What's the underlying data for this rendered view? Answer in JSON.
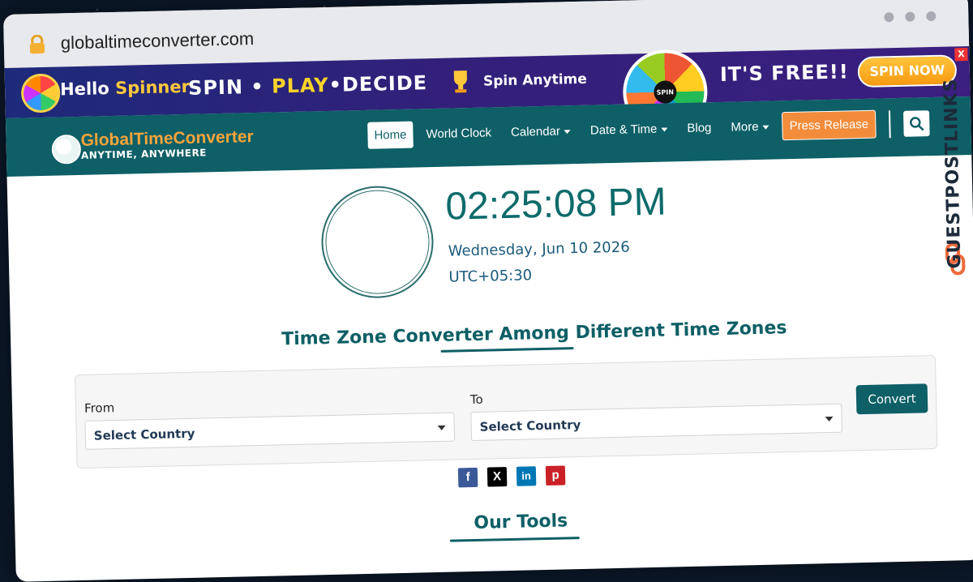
{
  "browser": {
    "url": "globaltimeconverter.com"
  },
  "ad": {
    "brand_hello": "Hello",
    "brand_spinner": "Spinner",
    "slogan_spin": "SPIN",
    "slogan_dot1": " • ",
    "slogan_play": "PLAY",
    "slogan_dot2": "•",
    "slogan_decide": "DECIDE",
    "anytime": "Spin Anytime",
    "wheel_label": "SPIN",
    "free": "IT'S FREE!!",
    "cta": "SPIN NOW",
    "close": "X"
  },
  "nav": {
    "logo_name": "GlobalTimeConverter",
    "logo_tagline": "ANYTIME, ANYWHERE",
    "items": [
      {
        "label": "Home",
        "active": true
      },
      {
        "label": "World Clock"
      },
      {
        "label": "Calendar",
        "dropdown": true
      },
      {
        "label": "Date & Time",
        "dropdown": true
      },
      {
        "label": "Blog"
      },
      {
        "label": "More",
        "dropdown": true
      }
    ],
    "press_release": "Press Release",
    "accent": "#0e5f66",
    "press_color": "#f28c3a"
  },
  "clock": {
    "time": "02:25:08 PM",
    "date": "Wednesday, Jun 10 2026",
    "utc": "UTC+05:30"
  },
  "converter": {
    "title": "Time Zone Converter Among Different Time Zones",
    "from_label": "From",
    "from_value": "Select Country",
    "to_label": "To",
    "to_value": "Select Country",
    "convert_button": "Convert"
  },
  "share": [
    {
      "icon": "facebook-icon",
      "glyph": "f",
      "color": "#3b5998"
    },
    {
      "icon": "x-icon",
      "glyph": "X",
      "color": "#000000"
    },
    {
      "icon": "linkedin-icon",
      "glyph": "in",
      "color": "#0077b5"
    },
    {
      "icon": "pinterest-icon",
      "glyph": "p",
      "color": "#cb2027"
    }
  ],
  "tools": {
    "title": "Our Tools"
  },
  "watermark": {
    "text": "GUESTPOSTLINKS"
  }
}
